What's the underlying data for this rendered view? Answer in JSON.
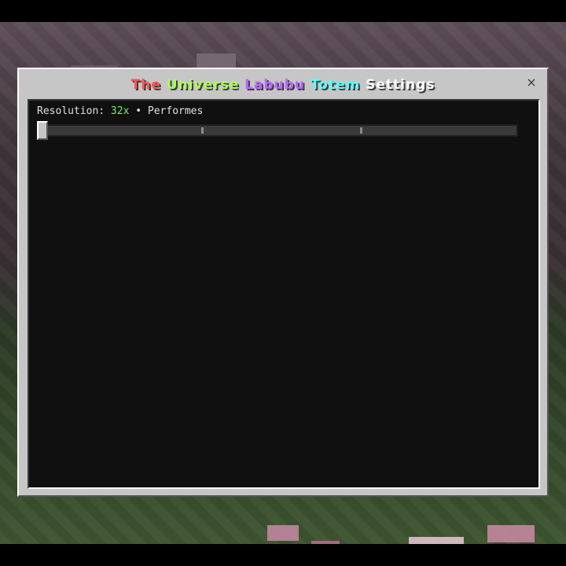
{
  "dialog": {
    "title_segments": [
      {
        "text": "The",
        "color": "#ff5555"
      },
      {
        "text": " ",
        "color": "#ffffff"
      },
      {
        "text": "Universe",
        "color": "#aaff55"
      },
      {
        "text": " ",
        "color": "#ffffff"
      },
      {
        "text": "Labubu",
        "color": "#bb66ff"
      },
      {
        "text": " ",
        "color": "#ffffff"
      },
      {
        "text": "Totem",
        "color": "#55ffff"
      },
      {
        "text": " Settings",
        "color": "#ffffff"
      }
    ],
    "close_label": "×"
  },
  "resolution": {
    "label": "Resolution:",
    "value": "32x",
    "separator": "•",
    "mode": "Performes",
    "value_color": "#55ff55",
    "slider_position": 0,
    "slider_steps": 3
  }
}
